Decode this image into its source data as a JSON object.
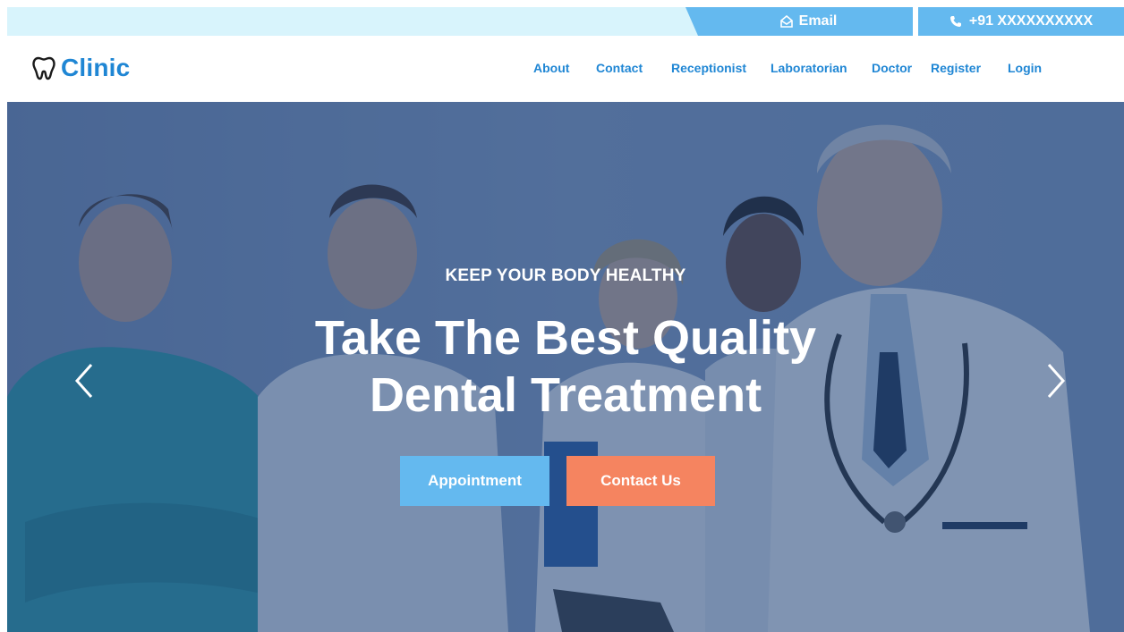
{
  "topbar": {
    "email_label": "Email",
    "email_icon": "envelope-icon",
    "phone_label": "+91 XXXXXXXXXX",
    "phone_icon": "phone-icon",
    "accent_color": "#64b9ef",
    "bar_color": "#d8f4fc"
  },
  "navbar": {
    "brand": "Clinic",
    "brand_icon": "tooth-icon",
    "brand_color": "#1f86d4",
    "links": [
      "About",
      "Contact",
      "Receptionist",
      "Laboratorian",
      "Doctor",
      "Register",
      "Login"
    ]
  },
  "hero": {
    "eyebrow": "KEEP YOUR BODY HEALTHY",
    "headline_line1": "Take The Best Quality",
    "headline_line2": "Dental Treatment",
    "appointment_button": "Appointment",
    "contact_button": "Contact Us",
    "appointment_color": "#64b9ef",
    "contact_color": "#f58460",
    "prev_icon": "chevron-left-icon",
    "next_icon": "chevron-right-icon",
    "background_image": "doctors-team-photo"
  }
}
